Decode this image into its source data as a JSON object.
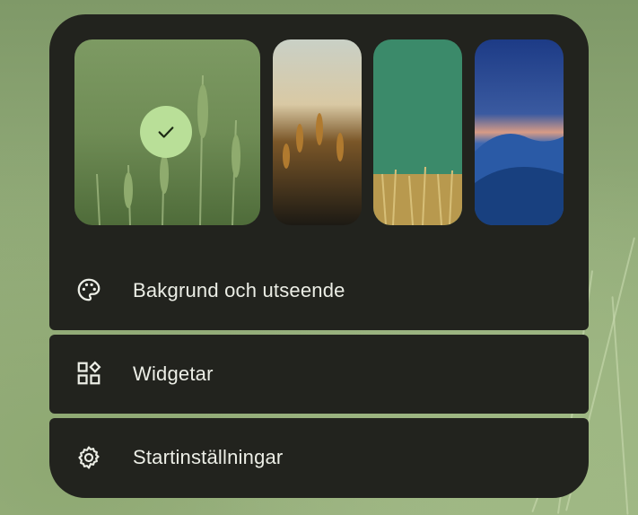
{
  "wallpaper_picker": {
    "thumbnails": [
      {
        "name": "wheat-field-green",
        "selected": true
      },
      {
        "name": "wheat-sunset",
        "selected": false
      },
      {
        "name": "wheat-teal",
        "selected": false
      },
      {
        "name": "desert-dunes-night",
        "selected": false
      }
    ],
    "selected_icon": "checkmark-icon"
  },
  "menu": {
    "items": [
      {
        "label": "Bakgrund och utseende",
        "icon": "palette-icon"
      },
      {
        "label": "Widgetar",
        "icon": "widgets-icon"
      },
      {
        "label": "Startinställningar",
        "icon": "gear-icon"
      }
    ]
  },
  "colors": {
    "panel": "#22231e",
    "selected_check": "#b9df98",
    "text": "#eceee6"
  }
}
